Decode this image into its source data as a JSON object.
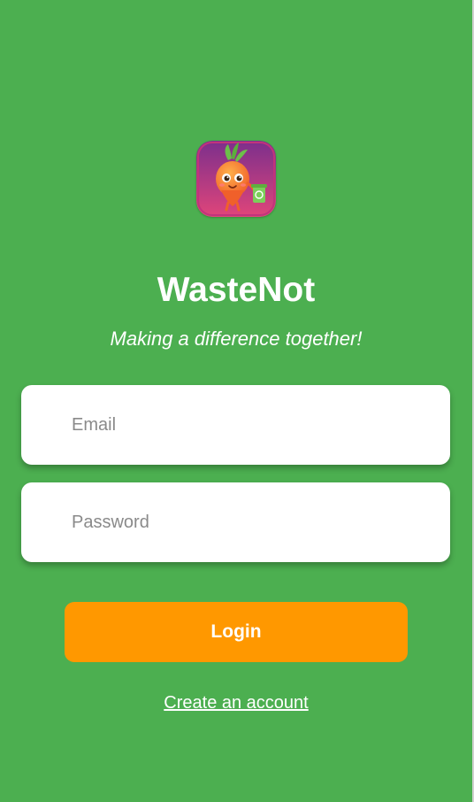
{
  "app": {
    "title": "WasteNot",
    "subtitle": "Making a difference together!",
    "logo_icon": "carrot-mascot-icon"
  },
  "form": {
    "email_placeholder": "Email",
    "email_value": "",
    "password_placeholder": "Password",
    "password_value": "",
    "login_label": "Login",
    "create_account_label": "Create an account"
  },
  "colors": {
    "background": "#4caf50",
    "button": "#ff9800",
    "field": "#ffffff",
    "text": "#ffffff"
  }
}
